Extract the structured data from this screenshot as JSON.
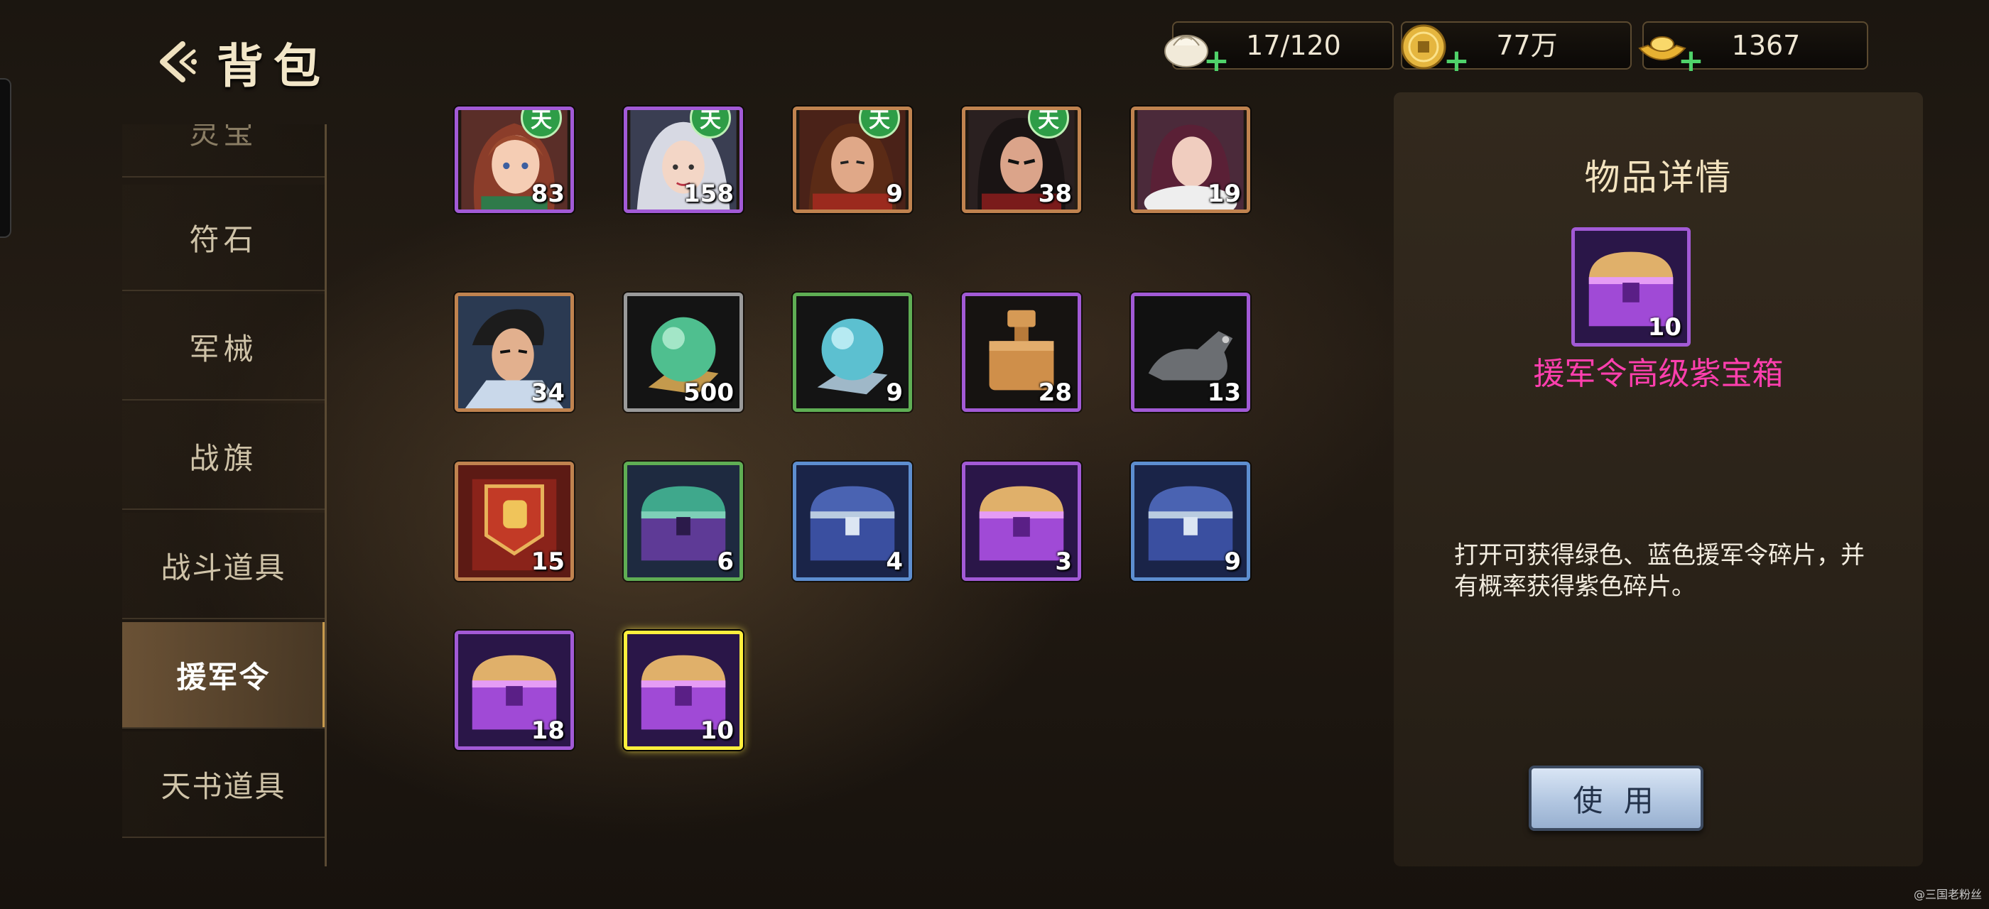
{
  "header": {
    "title": "背包",
    "resources": [
      {
        "name": "bun",
        "icon": "bun-icon",
        "value": "17/120"
      },
      {
        "name": "coin",
        "icon": "gold-coin-icon",
        "value": "77万"
      },
      {
        "name": "ingot",
        "icon": "gold-ingot-icon",
        "value": "1367"
      }
    ]
  },
  "sidebar": {
    "items": [
      {
        "label": "灵宝",
        "active": false
      },
      {
        "label": "符石",
        "active": false
      },
      {
        "label": "军械",
        "active": false
      },
      {
        "label": "战旗",
        "active": false
      },
      {
        "label": "战斗道具",
        "active": false
      },
      {
        "label": "援军令",
        "active": true
      },
      {
        "label": "天书道具",
        "active": false
      }
    ]
  },
  "grid": {
    "badge_text": "天",
    "items": [
      {
        "icon": "hero-portrait-girl-icon",
        "count": "83",
        "border": "purple",
        "badge": true
      },
      {
        "icon": "hero-portrait-silver-hair-icon",
        "count": "158",
        "border": "purple",
        "badge": true
      },
      {
        "icon": "hero-portrait-long-hair-warrior-icon",
        "count": "9",
        "border": "orange",
        "badge": true
      },
      {
        "icon": "hero-portrait-dark-warrior-icon",
        "count": "38",
        "border": "orange",
        "badge": true
      },
      {
        "icon": "hero-portrait-fur-lady-icon",
        "count": "19",
        "border": "orange",
        "badge": false
      },
      {
        "icon": "hero-portrait-swordsman-icon",
        "count": "34",
        "border": "orange",
        "badge": false
      },
      {
        "icon": "green-orb-icon",
        "count": "500",
        "border": "gray",
        "badge": false
      },
      {
        "icon": "cyan-orb-icon",
        "count": "9",
        "border": "green",
        "badge": false
      },
      {
        "icon": "bronze-seal-icon",
        "count": "28",
        "border": "purple",
        "badge": false
      },
      {
        "icon": "panther-statue-icon",
        "count": "13",
        "border": "purple",
        "badge": false
      },
      {
        "icon": "fist-banner-icon",
        "count": "15",
        "border": "orange",
        "badge": false
      },
      {
        "icon": "green-chest-icon",
        "count": "6",
        "border": "green",
        "badge": false
      },
      {
        "icon": "blue-chest-icon",
        "count": "4",
        "border": "blue",
        "badge": false
      },
      {
        "icon": "purple-chest-icon",
        "count": "3",
        "border": "purple",
        "badge": false
      },
      {
        "icon": "blue-chest-icon",
        "count": "9",
        "border": "blue",
        "badge": false
      },
      {
        "icon": "purple-chest-icon",
        "count": "18",
        "border": "purple",
        "badge": false
      },
      {
        "icon": "purple-chest-icon",
        "count": "10",
        "border": "yellow",
        "badge": false,
        "selected": true
      }
    ]
  },
  "detail": {
    "title": "物品详情",
    "item_icon": "purple-chest-icon",
    "item_count": "10",
    "item_name": "援军令高级紫宝箱",
    "description": "打开可获得绿色、蓝色援军令碎片，并有概率获得紫色碎片。",
    "use_button": "使 用"
  },
  "watermark": "@三国老粉丝",
  "colors": {
    "item_name": "#ff3fae",
    "accent_gold": "#c79a4d",
    "plus_green": "#4fd26a",
    "selected_border": "#ffef3d"
  }
}
